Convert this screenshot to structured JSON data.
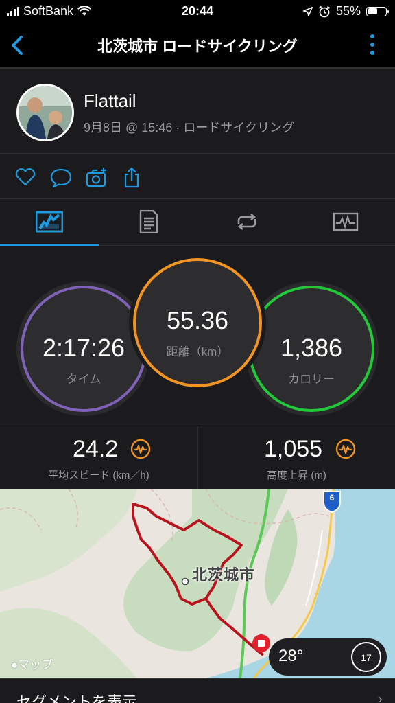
{
  "status_bar": {
    "carrier": "SoftBank",
    "time": "20:44",
    "battery": "55%",
    "battery_level": 0.55
  },
  "nav": {
    "title": "北茨城市 ロードサイクリング"
  },
  "activity": {
    "user": "Flattail",
    "meta": "9月8日 @ 15:46 · ロードサイクリング"
  },
  "tabs": [
    "stats-icon",
    "details-icon",
    "laps-icon",
    "graph-icon"
  ],
  "summary": {
    "time": {
      "value": "2:17:26",
      "label": "タイム",
      "color": "#8062b8"
    },
    "distance": {
      "value": "55.36",
      "label": "距離（km）",
      "color": "#f29422"
    },
    "calories": {
      "value": "1,386",
      "label": "カロリー",
      "color": "#23c93a"
    }
  },
  "stats": {
    "avg_speed": {
      "value": "24.2",
      "label": "平均スピード (km／h)"
    },
    "elevation": {
      "value": "1,055",
      "label": "高度上昇 (m)"
    }
  },
  "map": {
    "city": "北茨城市",
    "credit": "マップ",
    "route_badge": "6",
    "temperature": "28°",
    "wind": "17"
  },
  "segment": {
    "label": "セグメントを表示"
  },
  "colors": {
    "accent": "#1e9be0",
    "gauge": "#f29422",
    "route": "#b8141e"
  }
}
